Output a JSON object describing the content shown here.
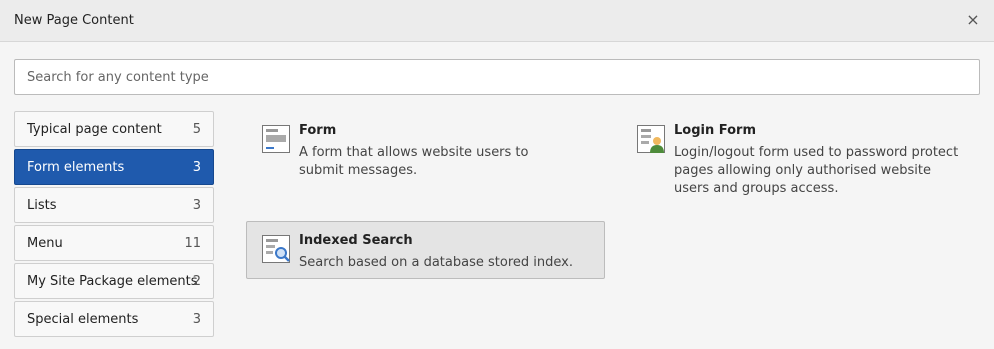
{
  "modal": {
    "title": "New Page Content",
    "close_symbol": "×"
  },
  "search": {
    "placeholder": "Search for any content type",
    "value": ""
  },
  "tabs": [
    {
      "label": "Typical page content",
      "count": "5",
      "active": false
    },
    {
      "label": "Form elements",
      "count": "3",
      "active": true
    },
    {
      "label": "Lists",
      "count": "3",
      "active": false
    },
    {
      "label": "Menu",
      "count": "11",
      "active": false
    },
    {
      "label": "My Site Package elements",
      "count": "2",
      "active": false
    },
    {
      "label": "Special elements",
      "count": "3",
      "active": false
    }
  ],
  "items": [
    {
      "title": "Form",
      "description": "A form that allows website users to submit messages.",
      "icon": "form-icon"
    },
    {
      "title": "Login Form",
      "description": "Login/logout form used to password protect pages allowing only authorised website users and groups access.",
      "icon": "login-form-icon"
    },
    {
      "title": "Indexed Search",
      "description": "Search based on a database stored index.",
      "icon": "indexed-search-icon"
    }
  ],
  "colors": {
    "active_tab": "#1f5aad",
    "icon_accent": "#3b78c9",
    "user_icon_head": "#f0b85e",
    "user_icon_body": "#4e8b3a"
  }
}
